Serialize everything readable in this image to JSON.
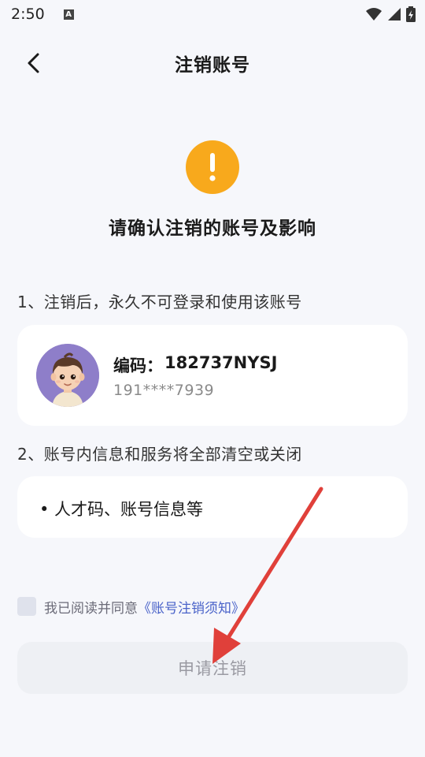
{
  "status_bar": {
    "time": "2:50",
    "notification_letter": "A"
  },
  "nav": {
    "title": "注销账号",
    "back_icon": "chevron-left-icon"
  },
  "warning": {
    "icon": "exclamation-circle-icon",
    "color": "#f8a91c",
    "title": "请确认注销的账号及影响"
  },
  "section1": {
    "label": "1、注销后，永久不可登录和使用该账号"
  },
  "account": {
    "code_label": "编码：",
    "code_value": "182737NYSJ",
    "phone": "191****7939"
  },
  "section2": {
    "label": "2、账号内信息和服务将全部清空或关闭",
    "items": [
      "• 人才码、账号信息等"
    ]
  },
  "agreement": {
    "prefix": "我已阅读并同意",
    "link": "《账号注销须知》",
    "checked": false
  },
  "apply_button": {
    "label": "申请注销"
  },
  "colors": {
    "accent_link": "#4a63c9",
    "annotation_arrow": "#e0403a"
  }
}
